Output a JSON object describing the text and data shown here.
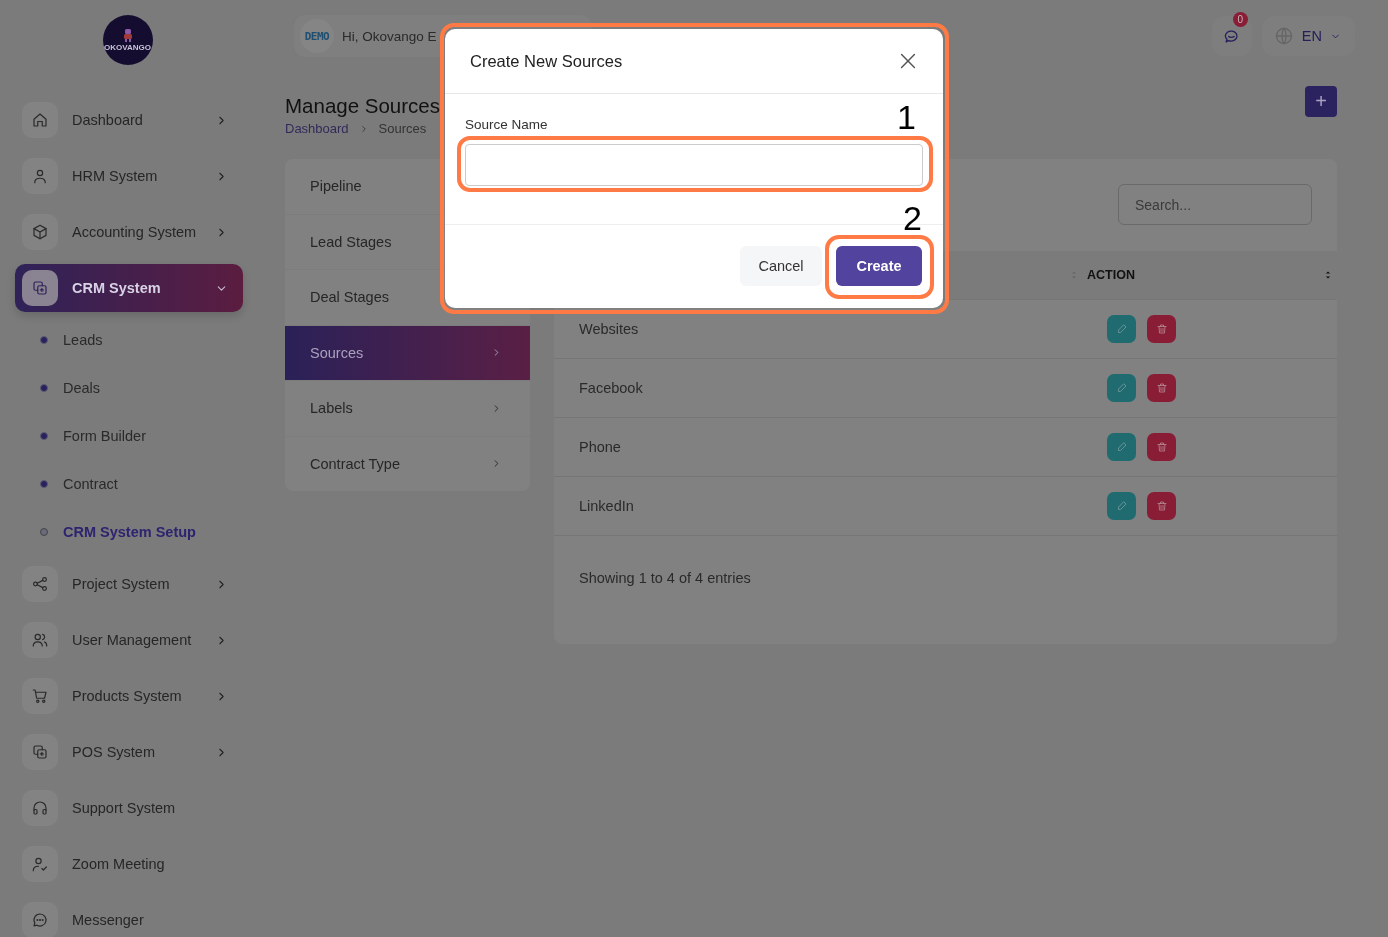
{
  "sidebar": {
    "logo": {
      "text": "OKOVANGO"
    },
    "items": [
      {
        "label": "Dashboard",
        "kind": "group",
        "expanded": false,
        "selected": false
      },
      {
        "label": "HRM System",
        "kind": "group",
        "expanded": false,
        "selected": false
      },
      {
        "label": "Accounting System",
        "kind": "group",
        "expanded": false,
        "selected": false
      },
      {
        "label": "CRM System",
        "kind": "group",
        "expanded": true,
        "selected": true,
        "children": [
          {
            "label": "Leads",
            "selected": false
          },
          {
            "label": "Deals",
            "selected": false
          },
          {
            "label": "Form Builder",
            "selected": false
          },
          {
            "label": "Contract",
            "selected": false
          },
          {
            "label": "CRM System Setup",
            "selected": true
          }
        ]
      },
      {
        "label": "Project System",
        "kind": "group",
        "expanded": false,
        "selected": false
      },
      {
        "label": "User Management",
        "kind": "group",
        "expanded": false,
        "selected": false
      },
      {
        "label": "Products System",
        "kind": "group",
        "expanded": false,
        "selected": false
      },
      {
        "label": "POS System",
        "kind": "group",
        "expanded": false,
        "selected": false
      },
      {
        "label": "Support System",
        "kind": "link",
        "selected": false
      },
      {
        "label": "Zoom Meeting",
        "kind": "link",
        "selected": false
      },
      {
        "label": "Messenger",
        "kind": "link",
        "selected": false
      }
    ]
  },
  "header": {
    "badge_text": "DEMO",
    "greeting": "Hi, Okovango E",
    "notification_count": "0",
    "language": "EN"
  },
  "page": {
    "title": "Manage Sources",
    "breadcrumb": [
      "Dashboard",
      "Sources"
    ],
    "add_button": "+"
  },
  "settings_menu": {
    "items": [
      {
        "label": "Pipeline",
        "selected": false
      },
      {
        "label": "Lead Stages",
        "selected": false
      },
      {
        "label": "Deal Stages",
        "selected": false
      },
      {
        "label": "Sources",
        "selected": true
      },
      {
        "label": "Labels",
        "selected": false
      },
      {
        "label": "Contract Type",
        "selected": false
      }
    ]
  },
  "table": {
    "search": {
      "placeholder": "Search..."
    },
    "action_header": "ACTION",
    "rows": [
      {
        "name": "Websites"
      },
      {
        "name": "Facebook"
      },
      {
        "name": "Phone"
      },
      {
        "name": "LinkedIn"
      }
    ],
    "footer": "Showing 1 to 4 of 4 entries"
  },
  "modal": {
    "title": "Create New Sources",
    "field_label": "Source Name",
    "cancel": "Cancel",
    "submit": "Create"
  },
  "annotations": [
    {
      "label": "1"
    },
    {
      "label": "2"
    }
  ]
}
